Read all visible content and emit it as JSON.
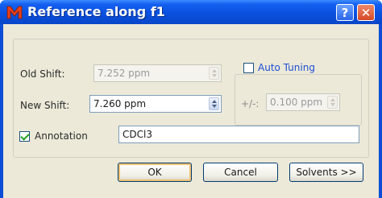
{
  "window": {
    "title": "Reference along f1",
    "app_icon": "m-logo-icon",
    "help_label": "?",
    "close_label": "✕"
  },
  "form": {
    "old_shift": {
      "label": "Old Shift:",
      "value": "7.252 ppm",
      "enabled": false
    },
    "new_shift": {
      "label": "New Shift:",
      "value": "7.260 ppm",
      "enabled": true
    },
    "auto_tuning": {
      "label": "Auto Tuning",
      "checked": false,
      "tolerance_label": "+/-:",
      "tolerance_value": "0.100 ppm",
      "enabled": false
    },
    "annotation": {
      "label": "Annotation",
      "checked": true,
      "value": "CDCl3"
    }
  },
  "buttons": {
    "ok": "OK",
    "cancel": "Cancel",
    "solvents": "Solvents >>"
  },
  "colors": {
    "titlebar": "#0a50e0",
    "dialog_bg": "#ece9d8",
    "link_text": "#1f4fd6",
    "check_mark": "#21a121"
  }
}
